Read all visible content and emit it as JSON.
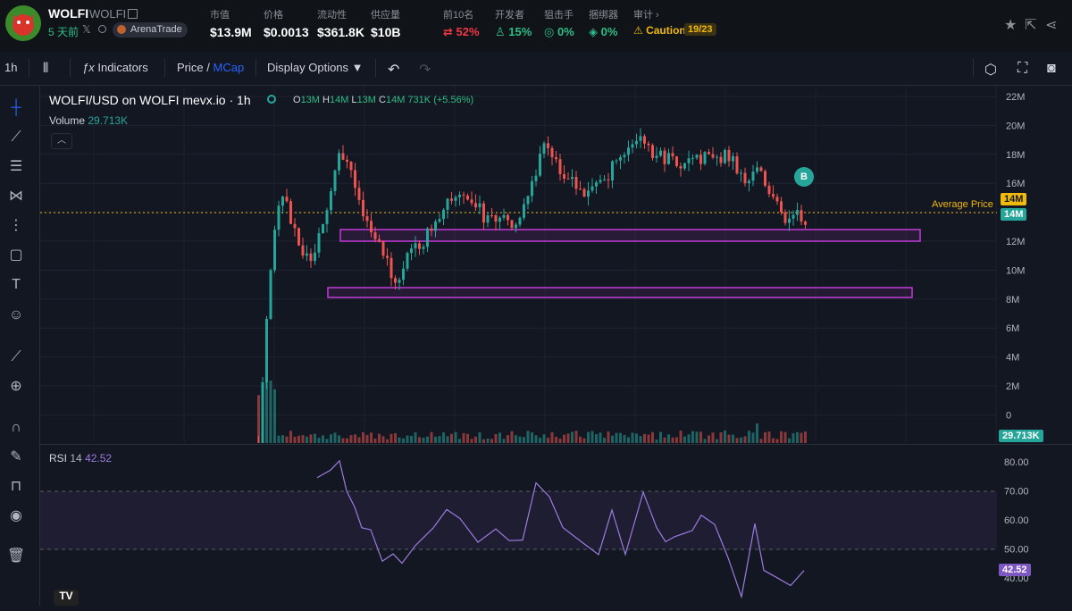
{
  "token": {
    "name": "WOLFI",
    "symbol": "WOLFI",
    "age": "5 天前",
    "platform_badge": "ArenaTrade"
  },
  "stats": [
    {
      "label": "市值",
      "value": "$13.9M"
    },
    {
      "label": "价格",
      "value": "$0.0013"
    },
    {
      "label": "流动性",
      "value": "$361.8K"
    },
    {
      "label": "供应量",
      "value": "$10B"
    }
  ],
  "holders": {
    "top10_label": "前10名",
    "top10_value": "52%",
    "dev_label": "开发者",
    "dev_value": "15%",
    "sniper_label": "狙击手",
    "sniper_value": "0%",
    "bundler_label": "捆绑器",
    "bundler_value": "0%",
    "audit_label": "审计",
    "audit_status": "Caution",
    "audit_score": "19/23"
  },
  "toolbar": {
    "interval": "1h",
    "indicators": "Indicators",
    "price": "Price",
    "slash": "/",
    "mcap": "MCap",
    "display_options": "Display Options"
  },
  "chart": {
    "title": "WOLFI/USD on WOLFI mevx.io · 1h",
    "ohlc": {
      "o": "13M",
      "h": "14M",
      "l": "13M",
      "c": "14M",
      "vol": "731K",
      "change": "(+5.56%)"
    },
    "volume_label": "Volume",
    "volume_value": "29.713K",
    "average_price_label": "Average Price",
    "avg_tag": "14M",
    "last_tag": "14M",
    "volume_tag": "29.713K",
    "buy_marker": "B",
    "price_axis": [
      "22M",
      "20M",
      "18M",
      "16M",
      "14M",
      "12M",
      "10M",
      "8M",
      "6M",
      "4M",
      "2M",
      "0"
    ],
    "colors": {
      "up": "#26a69a",
      "down": "#ef5350",
      "zone": "#c13bd8",
      "avg": "#f0b90b",
      "rsi": "#7e57c2"
    }
  },
  "rsi": {
    "label": "RSI",
    "period": "14",
    "value": "42.52",
    "axis": [
      "80.00",
      "70.00",
      "60.00",
      "50.00",
      "40.00"
    ]
  },
  "icons": [
    "star-icon",
    "share-out-icon",
    "share-icon",
    "candles-icon",
    "fx-icon",
    "undo-icon",
    "redo-icon",
    "settings-icon",
    "fullscreen-icon",
    "camera-icon",
    "crosshair-icon",
    "trendline-icon",
    "fib-icon",
    "pattern-icon",
    "projection-icon",
    "rectangle-icon",
    "text-icon",
    "emoji-icon",
    "ruler-icon",
    "zoom-icon",
    "magnet-icon",
    "lock-draw-icon",
    "lock-icon",
    "eye-icon",
    "trash-icon"
  ]
}
